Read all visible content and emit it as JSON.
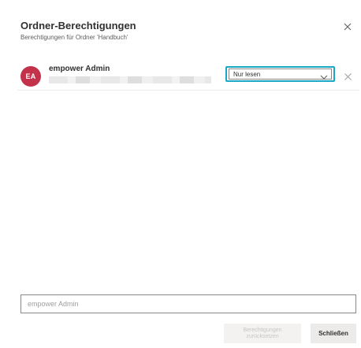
{
  "dialog": {
    "title": "Ordner-Berechtigungen",
    "subtitle": "Berechtigungen für Ordner 'Handbuch'",
    "close_icon": "close-icon"
  },
  "permissions": [
    {
      "initials": "EA",
      "avatar_color": "#c4314b",
      "name": "empower Admin",
      "permission": "Nur lesen"
    }
  ],
  "search": {
    "placeholder": "empower Admin"
  },
  "footer": {
    "reset_label": "Berechtigungen zurücksetzen",
    "close_label": "Schließen"
  },
  "colors": {
    "focus_accent": "#1aa7c6",
    "avatar": "#c4314b"
  }
}
